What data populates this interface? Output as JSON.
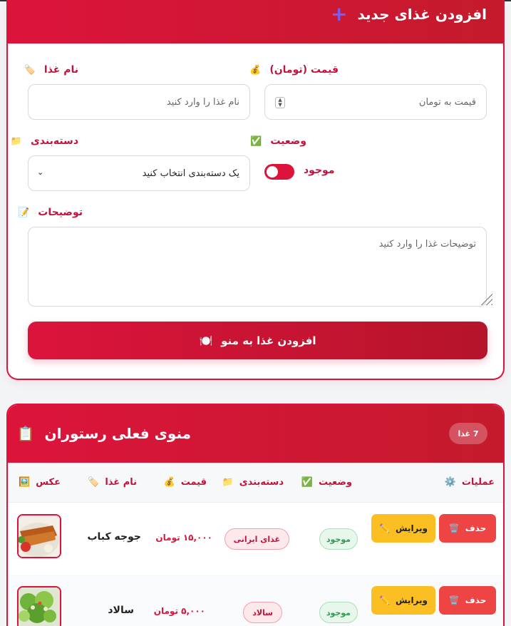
{
  "form": {
    "title": "افزودن غذای جدید",
    "title_icon": "plus-icon",
    "name_label": "نام غذا",
    "name_placeholder": "نام غذا را وارد کنید",
    "price_label": "قیمت (تومان)",
    "price_placeholder": "قیمت به تومان",
    "category_label": "دسته‌بندی",
    "category_selected": "یک دسته‌بندی انتخاب کنید",
    "status_label": "وضعیت",
    "status_toggle_label": "موجود",
    "description_label": "توضیحات",
    "description_placeholder": "توضیحات غذا را وارد کنید",
    "submit_label": "افزودن غذا به منو"
  },
  "menu": {
    "title": "منوی فعلی رستوران",
    "count_badge": "7 غذا",
    "columns": {
      "image": "عکس",
      "name": "نام غذا",
      "price": "قیمت",
      "category": "دسته‌بندی",
      "status": "وضعیت",
      "actions": "عملیات"
    },
    "items": [
      {
        "name": "جوجه کباب",
        "price": "۱۵,۰۰۰ تومان",
        "category": "غذای ایرانی",
        "status": "موجود",
        "edit": "ویرایش",
        "delete": "حذف"
      },
      {
        "name": "سالاد",
        "price": "۵,۰۰۰ تومان",
        "category": "سالاد",
        "status": "موجود",
        "edit": "ویرایش",
        "delete": "حذف"
      }
    ]
  },
  "colors": {
    "accent": "#dc143c",
    "edit": "#fbbf24",
    "delete": "#ef4444",
    "available": "#2e9b50"
  }
}
